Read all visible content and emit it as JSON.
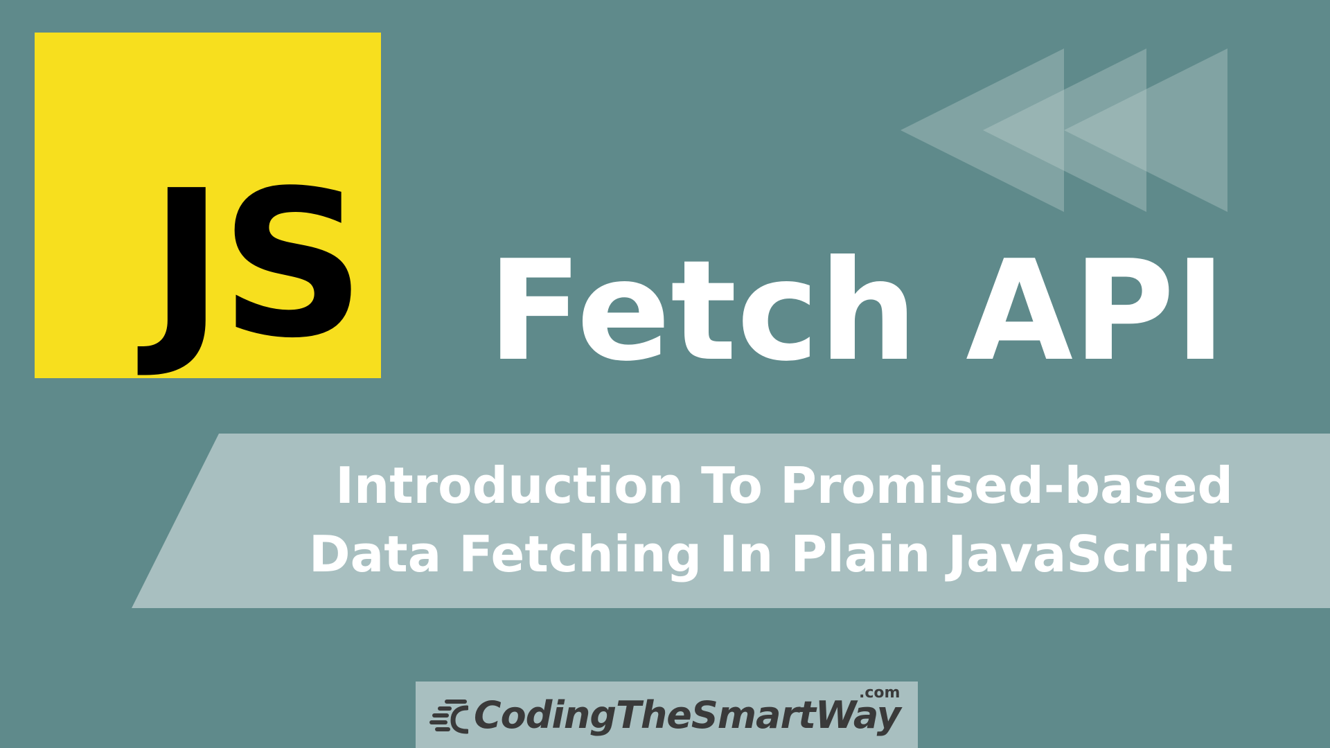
{
  "logo": {
    "text": "JS",
    "background_color": "#f7df1e",
    "text_color": "#000000"
  },
  "rewind_icon": {
    "name": "rewind-icon",
    "color": "#c9d9d8"
  },
  "title": "Fetch API",
  "subtitle": {
    "line1": "Introduction To Promised-based",
    "line2": "Data Fetching In Plain JavaScript"
  },
  "brand": {
    "name": "CodingTheSmartWay",
    "suffix": ".com",
    "icon": "speed-lines-icon"
  },
  "colors": {
    "background": "#5f8a8b",
    "banner": "#a8bfc0",
    "title": "#ffffff",
    "brand_text": "#3a3a3a"
  }
}
